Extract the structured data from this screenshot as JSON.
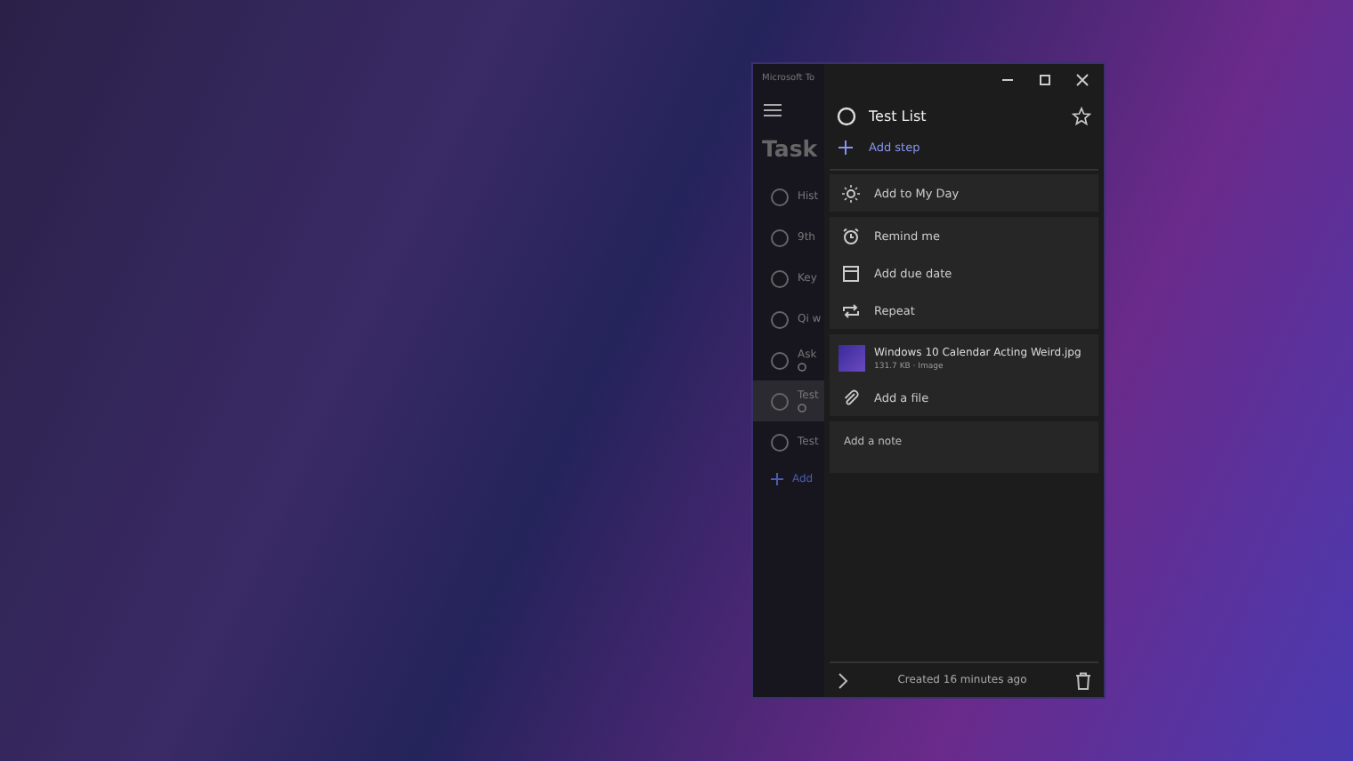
{
  "window": {
    "title": "Microsoft To"
  },
  "list_pane": {
    "heading": "Task",
    "tasks": [
      {
        "text": "Hist",
        "selected": false,
        "has_subline": false
      },
      {
        "text": "9th",
        "selected": false,
        "has_subline": false
      },
      {
        "text": "Key",
        "selected": false,
        "has_subline": false
      },
      {
        "text": "Qi w",
        "selected": false,
        "has_subline": false
      },
      {
        "text": "Ask",
        "selected": false,
        "has_subline": true
      },
      {
        "text": "Test",
        "selected": true,
        "has_subline": true
      },
      {
        "text": "Test",
        "selected": false,
        "has_subline": false
      }
    ],
    "add_task": "Add"
  },
  "detail": {
    "title": "Test List",
    "starred": false,
    "add_step": "Add step",
    "my_day": "Add to My Day",
    "options": [
      {
        "kind": "alarm",
        "label": "Remind me"
      },
      {
        "kind": "calendar",
        "label": "Add due date"
      },
      {
        "kind": "repeat",
        "label": "Repeat"
      }
    ],
    "attachment": {
      "name": "Windows 10 Calendar Acting Weird.jpg",
      "meta": "131.7 KB · Image"
    },
    "add_file": "Add a file",
    "note_placeholder": "Add a note",
    "footer": "Created 16 minutes ago"
  }
}
